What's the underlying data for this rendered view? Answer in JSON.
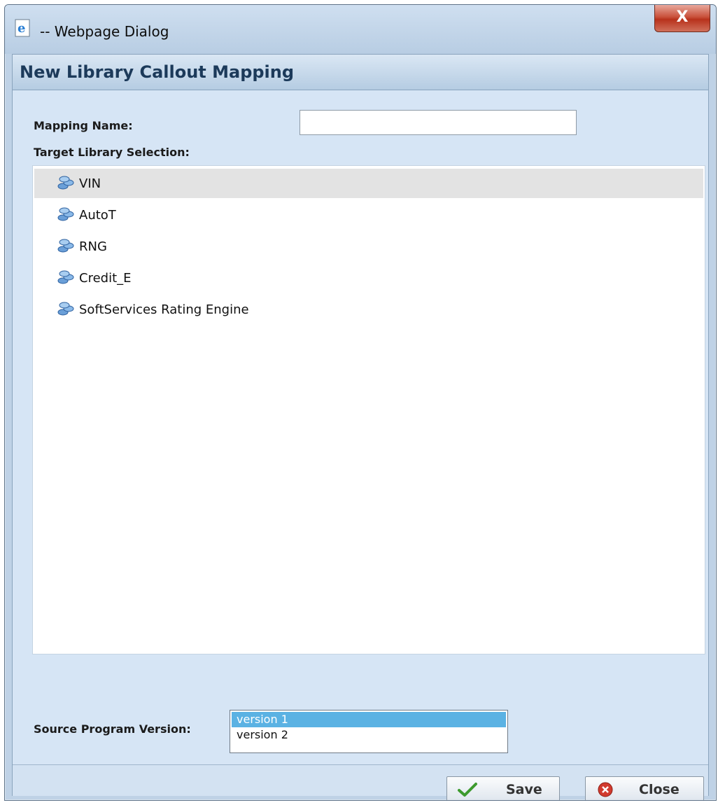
{
  "window": {
    "title": "-- Webpage Dialog",
    "close_glyph": "X"
  },
  "dialog": {
    "header": "New Library Callout Mapping"
  },
  "form": {
    "mapping_name_label": "Mapping Name:",
    "mapping_name_value": "",
    "target_library_label": "Target Library Selection:",
    "libraries": [
      {
        "label": "VIN",
        "selected": true
      },
      {
        "label": "AutoT",
        "selected": false
      },
      {
        "label": "RNG",
        "selected": false
      },
      {
        "label": "Credit_E",
        "selected": false
      },
      {
        "label": "SoftServices Rating Engine",
        "selected": false
      }
    ],
    "source_version_label": "Source Program Version:",
    "versions": [
      {
        "label": "version 1",
        "selected": true
      },
      {
        "label": "version 2",
        "selected": false
      }
    ]
  },
  "buttons": {
    "save": "Save",
    "close": "Close"
  },
  "colors": {
    "selection_blue": "#5bb2e3",
    "header_text": "#1c3a5a",
    "dialog_bg": "#d6e5f5"
  }
}
